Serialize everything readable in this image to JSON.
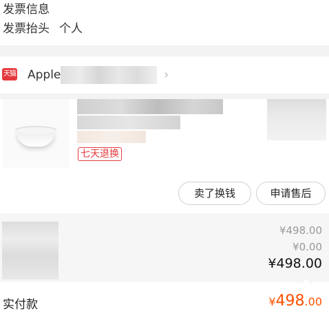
{
  "invoice": {
    "title": "发票信息",
    "header_label": "发票抬头",
    "header_value": "个人"
  },
  "store": {
    "badge": "天猫",
    "name": "Apple"
  },
  "product": {
    "service_tag": "七天退换",
    "sell_button": "卖了换钱",
    "after_sale_button": "申请售后"
  },
  "summary": {
    "goods_total": "¥498.00",
    "shipping": "¥0.00",
    "order_total": "¥498.00"
  },
  "paid": {
    "label": "实付款",
    "currency": "¥",
    "amount_int": "498",
    "amount_dec": ".00"
  },
  "colors": {
    "accent": "#ff5000",
    "tmall_red": "#e4393c"
  }
}
